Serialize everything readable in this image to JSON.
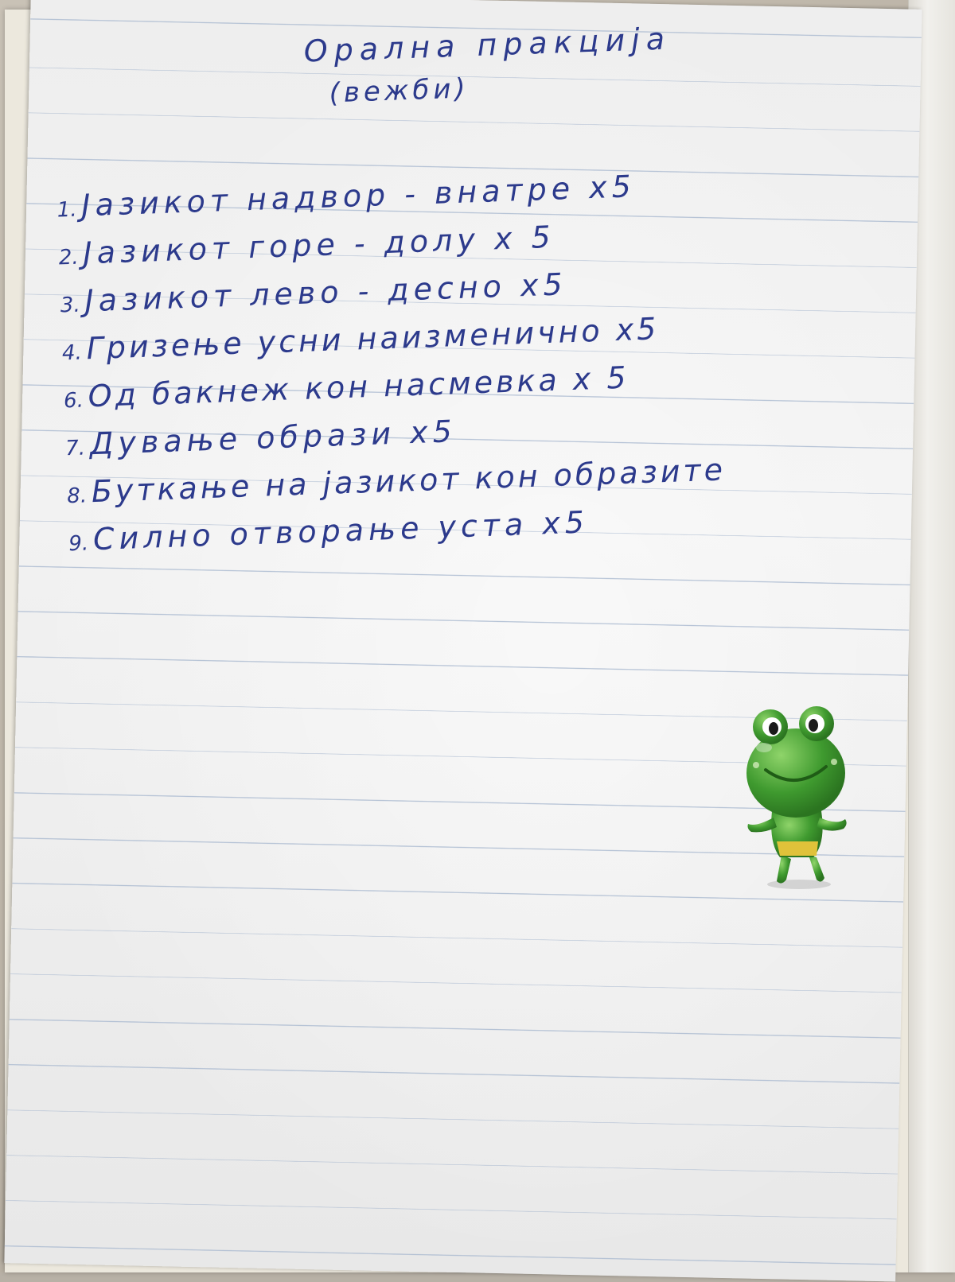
{
  "notebook": {
    "title": "Орална пракција",
    "subtitle": "(вежби)",
    "exercises": [
      {
        "number": "1.",
        "text": "Јазикот надвор - внатре х5"
      },
      {
        "number": "2.",
        "text": "Јазикот горе - долу х 5"
      },
      {
        "number": "3.",
        "text": "Јазикот лево - десно х5"
      },
      {
        "number": "4.",
        "text": "Гризење усни наизменично х5"
      },
      {
        "number": "6.",
        "text": "Од бакнеж кон насмевка х 5"
      },
      {
        "number": "7.",
        "text": "Дување образи х5"
      },
      {
        "number": "8.",
        "text": "Буткање на јазикот кон образите"
      },
      {
        "number": "9.",
        "text": "Силно отворање уста х5"
      }
    ],
    "ink_color": "#2c3a8c",
    "sticker": {
      "icon": "frog-sticker-icon",
      "color": "#3f9a2f",
      "belt_color": "#e0c23a"
    }
  }
}
